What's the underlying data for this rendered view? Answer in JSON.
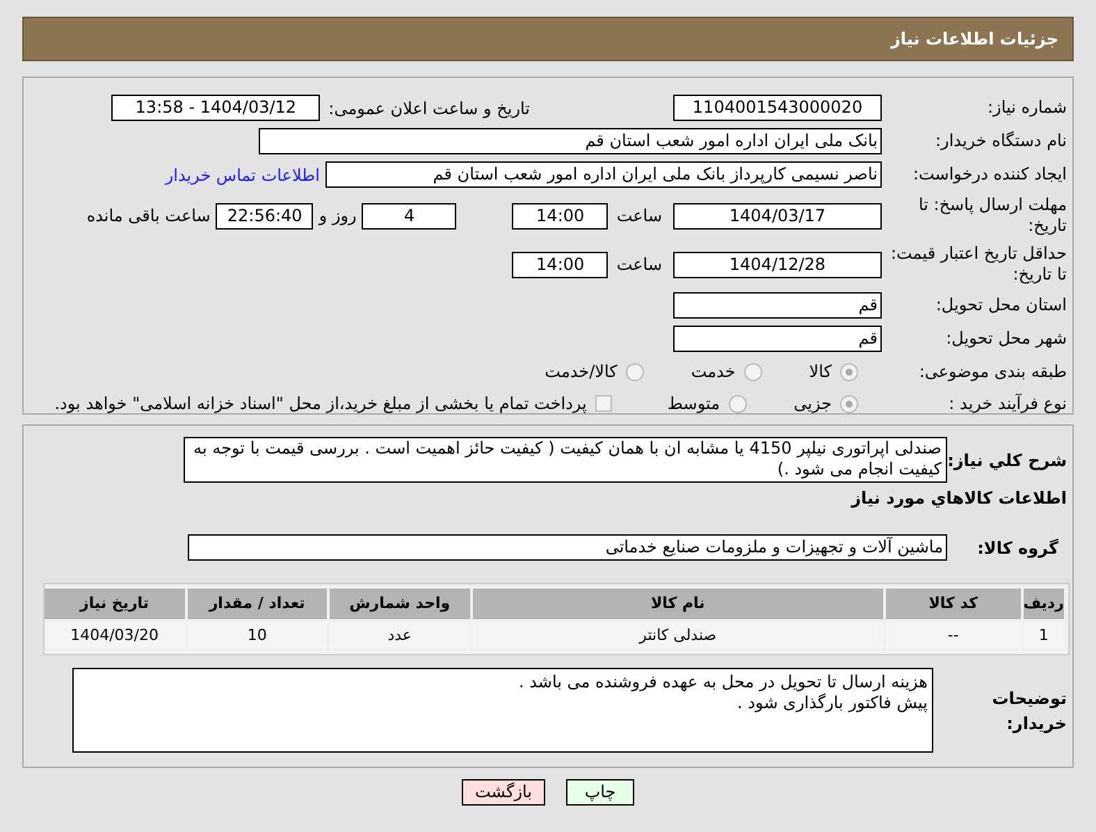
{
  "page_title": "جزئیات اطلاعات نیاز",
  "need_number": {
    "label": "شماره نیاز:",
    "value": "1104001543000020"
  },
  "announce": {
    "label": "تاریخ و ساعت اعلان عمومی:",
    "value": "1404/03/12 - 13:58"
  },
  "buyer_org": {
    "label": "نام دستگاه خریدار:",
    "value": "بانک ملی ایران اداره امور شعب استان قم"
  },
  "requester": {
    "label": "ایجاد کننده درخواست:",
    "value": "ناصر  نسیمی  کارپرداز  بانک ملی ایران اداره امور شعب استان قم",
    "link": "اطلاعات تماس خریدار"
  },
  "deadline": {
    "label": "مهلت ارسال پاسخ: تا تاریخ:",
    "date": "1404/03/17",
    "time_label": "ساعت",
    "time": "14:00",
    "days": "4",
    "days_label": "روز و",
    "remaining": "22:56:40",
    "remaining_label": "ساعت باقی مانده"
  },
  "price_validity": {
    "label": "حداقل تاریخ اعتبار قیمت: تا تاریخ:",
    "date": "1404/12/28",
    "time_label": "ساعت",
    "time": "14:00"
  },
  "province": {
    "label": "استان محل تحویل:",
    "value": "قم"
  },
  "city": {
    "label": "شهر محل تحویل:",
    "value": "قم"
  },
  "category": {
    "label": "طبقه بندی موضوعی:",
    "options": [
      {
        "label": "کالا",
        "selected": true
      },
      {
        "label": "خدمت",
        "selected": false
      },
      {
        "label": "کالا/خدمت",
        "selected": false
      }
    ]
  },
  "purchase_type": {
    "label": "نوع فرآیند خرید :",
    "options": [
      {
        "label": "جزیی",
        "selected": true
      },
      {
        "label": "متوسط",
        "selected": false
      }
    ],
    "checkbox": {
      "label": "پرداخت تمام یا بخشی از مبلغ خرید،از محل \"اسناد خزانه اسلامی\" خواهد بود.",
      "checked": false
    }
  },
  "description": {
    "label": "شرح کلي نياز:",
    "value": "صندلی اپراتوری نیلپر 4150 یا مشابه ان با همان کیفیت ( کیفیت حائز اهمیت است . بررسی قیمت با توجه به کیفیت انجام می شود .)"
  },
  "goods_heading": "اطلاعات کالاهاي مورد نياز",
  "goods_group": {
    "label": "گروه کالا:",
    "value": "ماشین آلات و تجهیزات و ملزومات صنایع خدماتی"
  },
  "table": {
    "columns": [
      "ردیف",
      "کد کالا",
      "نام کالا",
      "واحد شمارش",
      "تعداد / مقدار",
      "تاریخ نیاز"
    ],
    "rows": [
      [
        "1",
        "--",
        "صندلی کانتر",
        "عدد",
        "10",
        "1404/03/20"
      ]
    ]
  },
  "buyer_notes": {
    "label": "توضیحات خریدار:",
    "value": "هزینه ارسال تا تحویل در محل به عهده فروشنده می باشد .\nپیش فاکتور بارگذاری شود ."
  },
  "buttons": [
    {
      "label": "چاپ",
      "kind": "print"
    },
    {
      "label": "بازگشت",
      "kind": "back"
    }
  ]
}
